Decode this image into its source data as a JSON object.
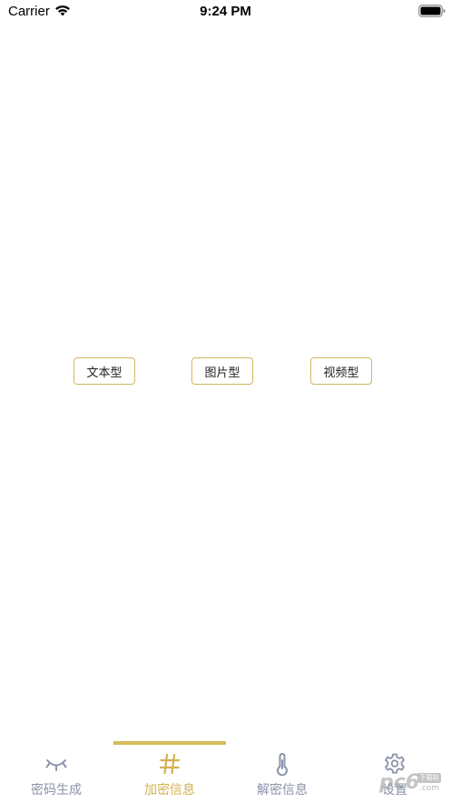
{
  "status_bar": {
    "carrier": "Carrier",
    "time": "9:24 PM",
    "icons": [
      "wifi-icon",
      "battery-icon"
    ]
  },
  "content": {
    "buttons": [
      {
        "label": "文本型"
      },
      {
        "label": "图片型"
      },
      {
        "label": "视频型"
      }
    ]
  },
  "tab_bar": {
    "active_index": 1,
    "active_color": "#d3b04f",
    "inactive_color": "#8a93a8",
    "indicator_color": "#d6bb58",
    "tabs": [
      {
        "label": "密码生成",
        "icon": "closed-eye-icon"
      },
      {
        "label": "加密信息",
        "icon": "hash-icon"
      },
      {
        "label": "解密信息",
        "icon": "thermometer-icon"
      },
      {
        "label": "设置",
        "icon": "gear-icon"
      }
    ]
  },
  "watermark": {
    "big": "pc6",
    "box": "下载站",
    "small": ".com"
  },
  "colors": {
    "button_border": "#d3b65e",
    "button_text": "#222222"
  }
}
